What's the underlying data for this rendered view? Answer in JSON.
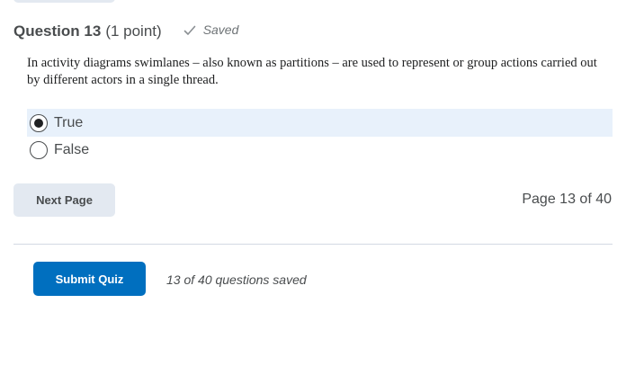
{
  "question": {
    "title": "Question 13",
    "points": "(1 point)",
    "status": "Saved",
    "text": "In activity diagrams swimlanes – also known as partitions – are used to represent or group actions carried out by different actors in a single thread."
  },
  "options": [
    {
      "label": "True",
      "selected": true
    },
    {
      "label": "False",
      "selected": false
    }
  ],
  "navigation": {
    "next_label": "Next Page",
    "page_indicator": "Page 13 of 40"
  },
  "footer": {
    "submit_label": "Submit Quiz",
    "saved_count": "13 of 40 questions saved"
  },
  "colors": {
    "accent": "#006fbf",
    "selected_row": "#e8f1fb",
    "secondary_button": "#e3e9f1"
  },
  "icons": {
    "saved": "check-icon"
  }
}
